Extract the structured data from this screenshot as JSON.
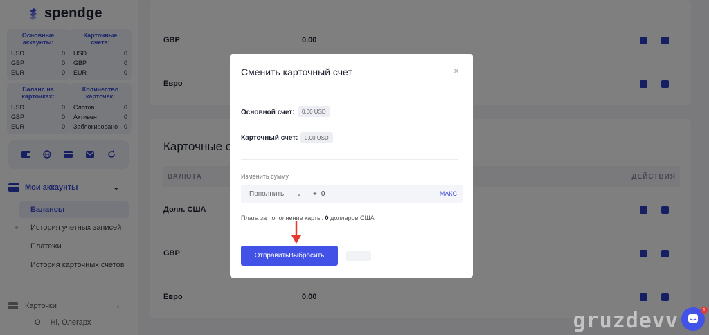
{
  "brand": {
    "name": "spendge",
    "accent": "#4251e6"
  },
  "stats": {
    "main_accounts": {
      "title": "Основные аккаунты:",
      "rows": [
        [
          "USD",
          "0"
        ],
        [
          "GBP",
          "0"
        ],
        [
          "EUR",
          "0"
        ]
      ]
    },
    "card_accounts": {
      "title": "Карточные счета:",
      "rows": [
        [
          "USD",
          "0"
        ],
        [
          "GBP",
          "0"
        ],
        [
          "EUR",
          "0"
        ]
      ]
    },
    "card_balance": {
      "title": "Баланс на карточках:",
      "rows": [
        [
          "USD",
          "0"
        ],
        [
          "GBP",
          "0"
        ],
        [
          "EUR",
          "0"
        ]
      ]
    },
    "card_count": {
      "title": "Количество карточек:",
      "rows": [
        [
          "Слотов",
          "0"
        ],
        [
          "Активен",
          "0"
        ],
        [
          "Заблокировано",
          "0"
        ]
      ]
    }
  },
  "sidebar": {
    "icons": [
      "card-icon",
      "globe-icon",
      "wallet-icon",
      "mail-icon",
      "refresh-icon"
    ],
    "my_accounts": "Мои аккаунты",
    "items": [
      {
        "label": "Балансы",
        "active": true
      },
      {
        "label": "История учетных записей",
        "active": false
      },
      {
        "label": "Платежи",
        "active": false
      },
      {
        "label": "История карточных счетов",
        "active": false
      }
    ],
    "cards": "Карточки",
    "user": {
      "initial": "O",
      "greeting": "Hi, Олегарх"
    }
  },
  "main": {
    "top_rows": [
      {
        "currency": "GBP",
        "amount": "0.00"
      },
      {
        "currency": "Евро",
        "amount": ""
      }
    ],
    "section_title": "Карточные сч",
    "table_headers": {
      "currency": "ВАЛЮТА",
      "actions": "ДЕЙСТВИЯ"
    },
    "rows": [
      {
        "currency": "Долл. США",
        "amount": ""
      },
      {
        "currency": "GBP",
        "amount": ""
      },
      {
        "currency": "Евро",
        "amount": "0.00"
      }
    ]
  },
  "modal": {
    "title": "Сменить карточный счет",
    "close": "×",
    "main_account_label": "Основной счет:",
    "main_account_value": "0.00 USD",
    "card_account_label": "Карточный счет:",
    "card_account_value": "0.00 USD",
    "change_amount_label": "Изменить сумму",
    "operation_selected": "Пополнить",
    "amount_prefix": "+",
    "amount_value": "0",
    "max_label": "МАКС",
    "fee_prefix": "Плата за пополнение карты:",
    "fee_value": "0",
    "fee_suffix": "долларов США",
    "submit_label": "ОтправитьВыбросить"
  },
  "watermark": "gruzdevv",
  "chat": {
    "badge": "1"
  }
}
